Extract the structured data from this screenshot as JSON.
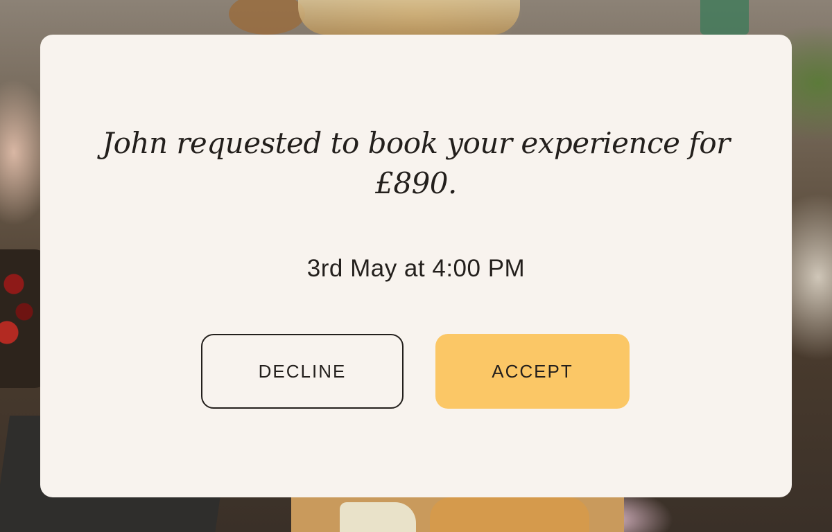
{
  "background": {
    "description_icon": "picnic-photo-background"
  },
  "modal": {
    "title": "John requested to book your experience for £890.",
    "datetime": "3rd May at 4:00 PM",
    "decline_label": "DECLINE",
    "accept_label": "ACCEPT"
  },
  "colors": {
    "card_background": "#f8f3ee",
    "accent": "#fbc766",
    "text": "#231f1c"
  }
}
